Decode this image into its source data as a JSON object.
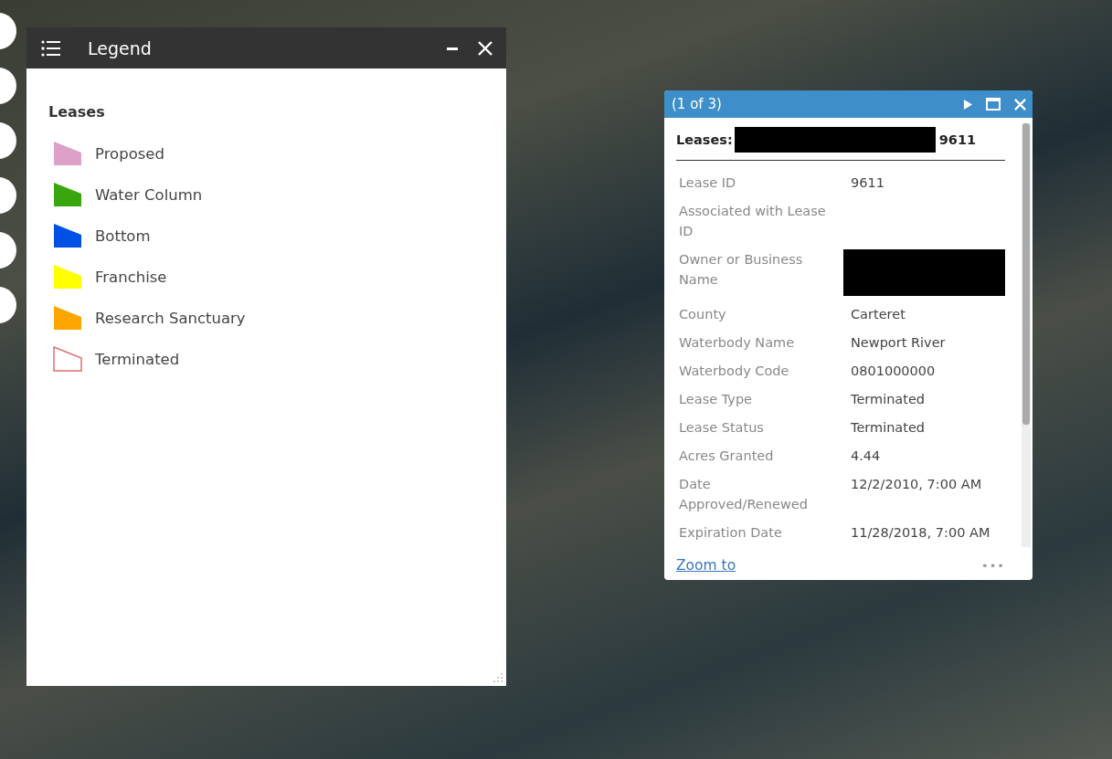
{
  "legend": {
    "title": "Legend",
    "layer": "Leases",
    "items": [
      {
        "label": "Proposed",
        "kind": "filled",
        "color": "#dda0c8"
      },
      {
        "label": "Water Column",
        "kind": "filled",
        "color": "#3aa60e"
      },
      {
        "label": "Bottom",
        "kind": "filled",
        "color": "#0050e6"
      },
      {
        "label": "Franchise",
        "kind": "filled",
        "color": "#ffff00"
      },
      {
        "label": "Research Sanctuary",
        "kind": "filled",
        "color": "#ffa500"
      },
      {
        "label": "Terminated",
        "kind": "outline",
        "color": "#e07070"
      }
    ]
  },
  "popup": {
    "counter": "(1 of 3)",
    "title_label": "Leases:",
    "title_redacted": true,
    "title_suffix": "9611",
    "fields": [
      {
        "label": "Lease ID",
        "value": "9611",
        "redacted": false
      },
      {
        "label": "Associated with Lease ID",
        "redacted": false
      },
      {
        "label": "Owner or Business Name",
        "redacted": true
      },
      {
        "label": "County",
        "value": "Carteret",
        "redacted": false
      },
      {
        "label": "Waterbody Name",
        "value": "Newport River",
        "redacted": false
      },
      {
        "label": "Waterbody Code",
        "value": "0801000000",
        "redacted": false
      },
      {
        "label": "Lease Type",
        "value": "Terminated",
        "redacted": false
      },
      {
        "label": "Lease Status",
        "value": "Terminated",
        "redacted": false
      },
      {
        "label": "Acres Granted",
        "value": "4.44",
        "redacted": false
      },
      {
        "label": "Date Approved/Renewed",
        "value": "12/2/2010, 7:00 AM",
        "redacted": false
      },
      {
        "label": "Expiration Date",
        "value": "11/28/2018, 7:00 AM",
        "redacted": false
      }
    ],
    "link": "Zoom to",
    "more": "•••"
  }
}
